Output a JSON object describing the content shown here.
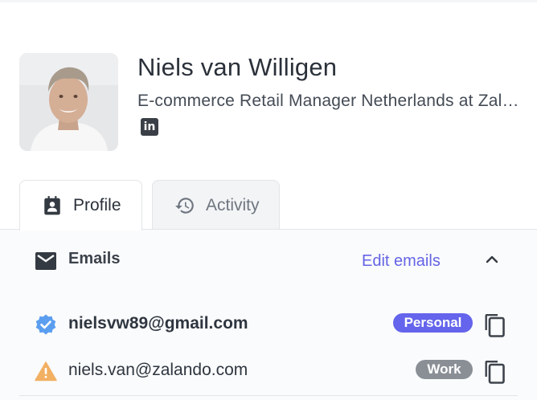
{
  "profile": {
    "name": "Niels van Willigen",
    "headline": "E-commerce Retail Manager Netherlands at Zalando",
    "social": {
      "network": "LinkedIn",
      "icon": "linkedin-icon",
      "glyph": "in"
    },
    "avatar": {
      "icon": "person-photo"
    }
  },
  "tabs": [
    {
      "label": "Profile",
      "icon": "contact-card-icon",
      "active": true
    },
    {
      "label": "Activity",
      "icon": "history-icon",
      "active": false
    }
  ],
  "emails_section": {
    "title": "Emails",
    "icon": "mail-icon",
    "edit_label": "Edit emails",
    "collapse_icon": "chevron-up-icon",
    "items": [
      {
        "address": "nielsvw89@gmail.com",
        "status_icon": "verified-badge-icon",
        "type": "Personal",
        "primary": true
      },
      {
        "address": "niels.van@zalando.com",
        "status_icon": "warning-icon",
        "type": "Work",
        "primary": false
      }
    ]
  },
  "colors": {
    "accent": "#6464e6",
    "personal_badge": "#6464ec",
    "work_badge": "#8a8f96",
    "verified": "#5b9ef0",
    "warning": "#f2b063",
    "text": "#2f3640"
  }
}
